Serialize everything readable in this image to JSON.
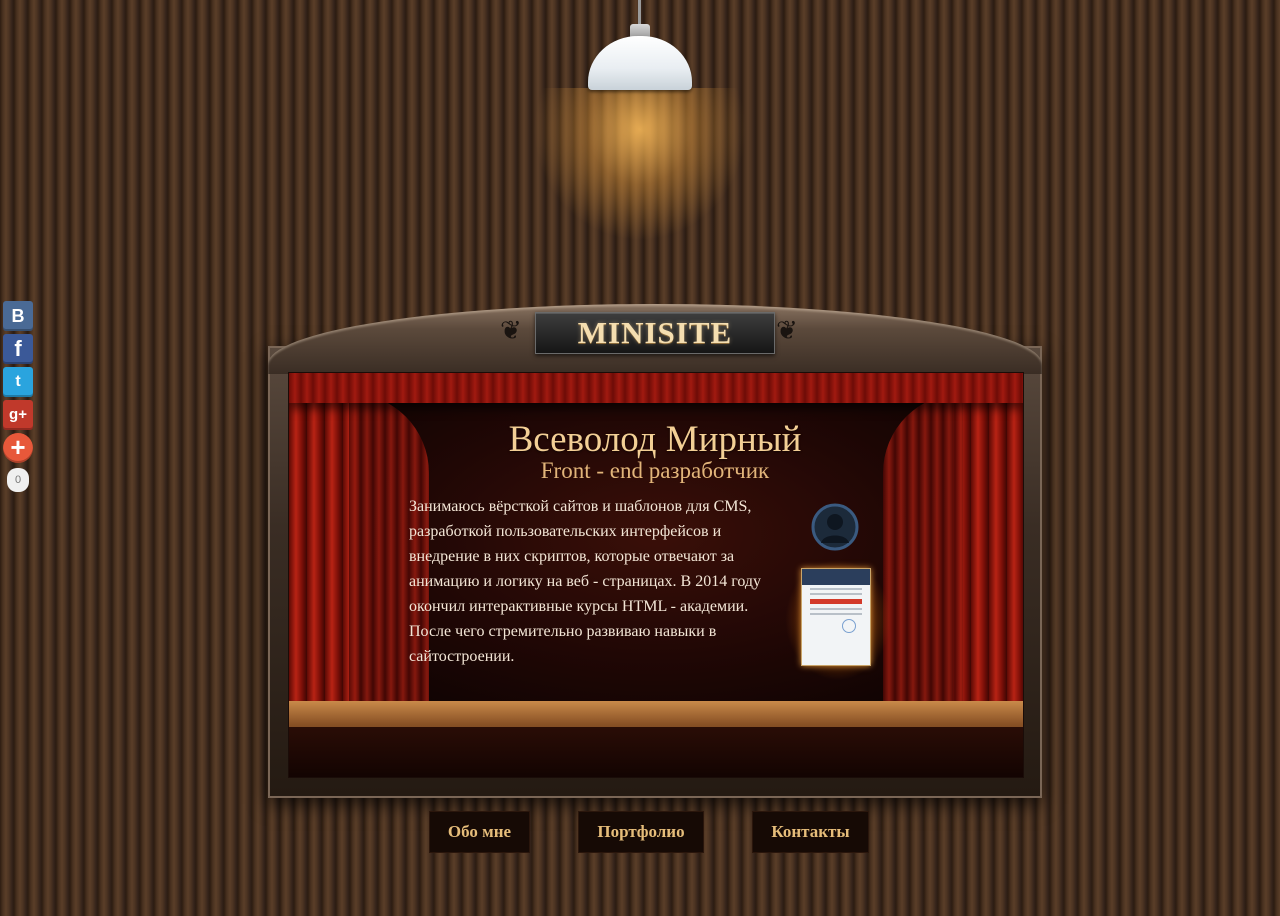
{
  "logo": {
    "text": "MINISITE"
  },
  "profile": {
    "name": "Всеволод Мирный",
    "role": "Front - end разработчик",
    "bio": "Занимаюсь вёрсткой сайтов и шаблонов для CMS, разработкой пользовательских интерфейсов и внедрение в них скриптов, которые отвечают за анимацию и логику на веб - страницах. В 2014 году окончил интерактивные курсы HTML - академии. После чего стремительно развиваю навыки в сайтостроении."
  },
  "social": {
    "items": [
      {
        "name": "vk",
        "glyph": "B",
        "color": "#4a6a95",
        "icon": "vk-icon"
      },
      {
        "name": "facebook",
        "glyph": "f",
        "color": "#3b5998",
        "icon": "facebook-icon"
      },
      {
        "name": "twitter",
        "glyph": "t",
        "color": "#2aa4de",
        "icon": "twitter-icon"
      },
      {
        "name": "googleplus",
        "glyph": "g+",
        "color": "#c0392b",
        "icon": "google-plus-icon"
      },
      {
        "name": "more",
        "glyph": "+",
        "color": "#e7583a",
        "icon": "plus-icon"
      }
    ],
    "share_count": "0"
  },
  "nav": {
    "about": "Обо мне",
    "portfolio": "Портфолио",
    "contacts": "Контакты"
  },
  "colors": {
    "accent_text": "#f3cf95",
    "button_text": "#e6bd7a",
    "button_bg": "#160a05"
  }
}
